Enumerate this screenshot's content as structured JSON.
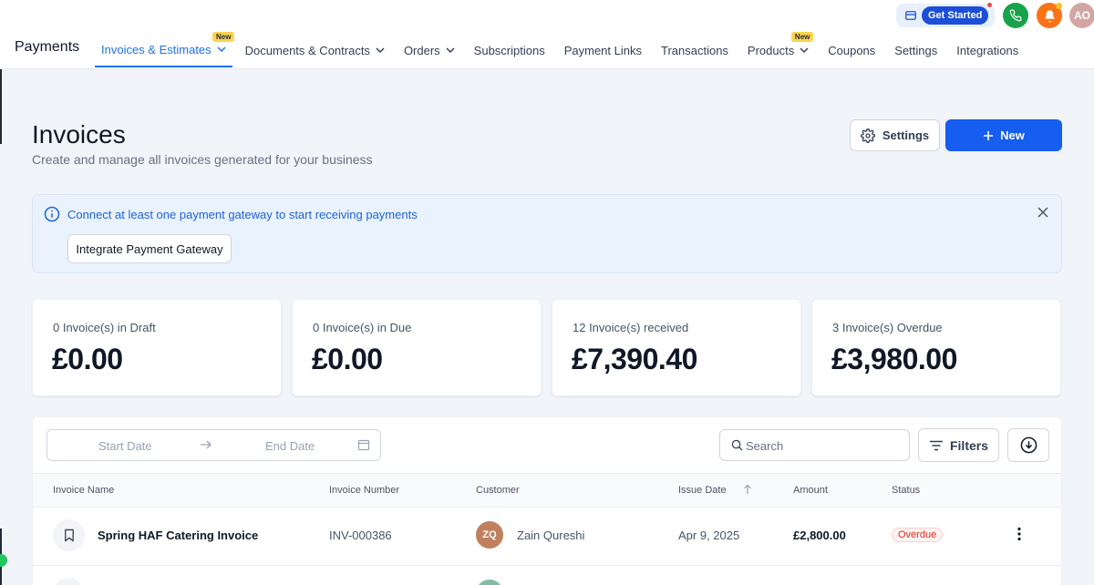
{
  "brand": "Payments",
  "nav": [
    {
      "label": "Invoices & Estimates",
      "badge": "New",
      "dropdown": true,
      "active": true
    },
    {
      "label": "Documents & Contracts",
      "dropdown": true
    },
    {
      "label": "Orders",
      "dropdown": true
    },
    {
      "label": "Subscriptions"
    },
    {
      "label": "Payment Links"
    },
    {
      "label": "Transactions"
    },
    {
      "label": "Products",
      "badge": "New",
      "dropdown": true
    },
    {
      "label": "Coupons"
    },
    {
      "label": "Settings"
    },
    {
      "label": "Integrations"
    }
  ],
  "topbar": {
    "get_started": "Get Started",
    "avatar_initials": "AO"
  },
  "page": {
    "title": "Invoices",
    "subtitle": "Create and manage all invoices generated for your business",
    "settings_label": "Settings",
    "new_label": "New"
  },
  "alert": {
    "message": "Connect at least one payment gateway to start receiving payments",
    "button": "Integrate Payment Gateway"
  },
  "stats": [
    {
      "label": "0 Invoice(s) in Draft",
      "value": "£0.00"
    },
    {
      "label": "0 Invoice(s) in Due",
      "value": "£0.00"
    },
    {
      "label": "12 Invoice(s) received",
      "value": "£7,390.40"
    },
    {
      "label": "3 Invoice(s) Overdue",
      "value": "£3,980.00"
    }
  ],
  "filters": {
    "start_date_placeholder": "Start Date",
    "end_date_placeholder": "End Date",
    "search_placeholder": "Search",
    "filters_label": "Filters"
  },
  "table": {
    "columns": [
      "Invoice Name",
      "Invoice Number",
      "Customer",
      "Issue Date",
      "Amount",
      "Status"
    ],
    "rows": [
      {
        "name": "Spring HAF Catering Invoice",
        "number": "INV-000386",
        "customer_initials": "ZQ",
        "customer": "Zain Qureshi",
        "issue_date": "Apr 9, 2025",
        "amount": "£2,800.00",
        "status": "Overdue"
      }
    ]
  },
  "colors": {
    "primary": "#155eef",
    "active_tab": "#1d72ee",
    "overdue": "#d92d20",
    "badge_new": "#fcd34d"
  }
}
